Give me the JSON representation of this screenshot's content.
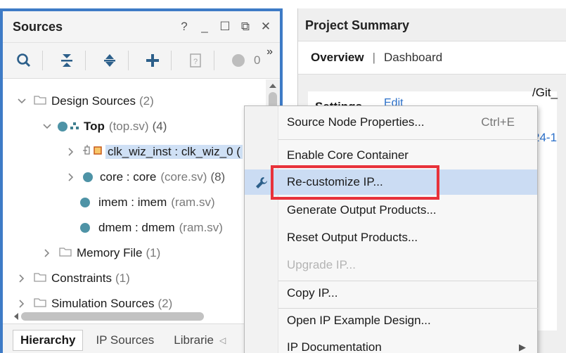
{
  "sources": {
    "title": "Sources",
    "controls": {
      "help": "?",
      "minimize": "_",
      "maximize": "☐",
      "float": "⧉",
      "close": "✕"
    },
    "toolbar": {
      "count": "0",
      "more": "»"
    },
    "tree": {
      "design_sources": {
        "label": "Design Sources",
        "count": "(2)"
      },
      "top": {
        "label": "Top",
        "file": "(top.sv)",
        "count": "(4)"
      },
      "clk": {
        "label": "clk_wiz_inst : clk_wiz_0 ("
      },
      "core": {
        "label": "core : core",
        "file": "(core.sv)",
        "count": "(8)"
      },
      "imem": {
        "label": "imem : imem",
        "file": "(ram.sv)"
      },
      "dmem": {
        "label": "dmem : dmem",
        "file": "(ram.sv)"
      },
      "memory_file": {
        "label": "Memory File",
        "count": "(1)"
      },
      "constraints": {
        "label": "Constraints",
        "count": "(1)"
      },
      "simulation": {
        "label": "Simulation Sources",
        "count": "(2)"
      }
    },
    "bottom_tabs": [
      "Hierarchy",
      "IP Sources",
      "Librarie"
    ]
  },
  "project": {
    "title": "Project Summary",
    "tabs": {
      "overview": "Overview",
      "separator": "|",
      "dashboard": "Dashboard"
    },
    "settings_label": "Settings",
    "edit_link": "Edit",
    "fragment_path": "/Git_",
    "fragment_link": "24-1"
  },
  "context_menu": {
    "items": [
      {
        "label": "Source Node Properties...",
        "shortcut": "Ctrl+E"
      },
      {
        "label": "Enable Core Container"
      },
      {
        "label": "Re-customize IP..."
      },
      {
        "label": "Generate Output Products..."
      },
      {
        "label": "Reset Output Products..."
      },
      {
        "label": "Upgrade IP..."
      },
      {
        "label": "Copy IP..."
      },
      {
        "label": "Open IP Example Design..."
      },
      {
        "label": "IP Documentation"
      }
    ]
  },
  "colors": {
    "panel_border": "#3e7bc6",
    "highlight_box": "#e8323a",
    "menu_hover": "#cbdcf3",
    "link": "#2a6fc9",
    "node_dot": "#4e93a6"
  }
}
